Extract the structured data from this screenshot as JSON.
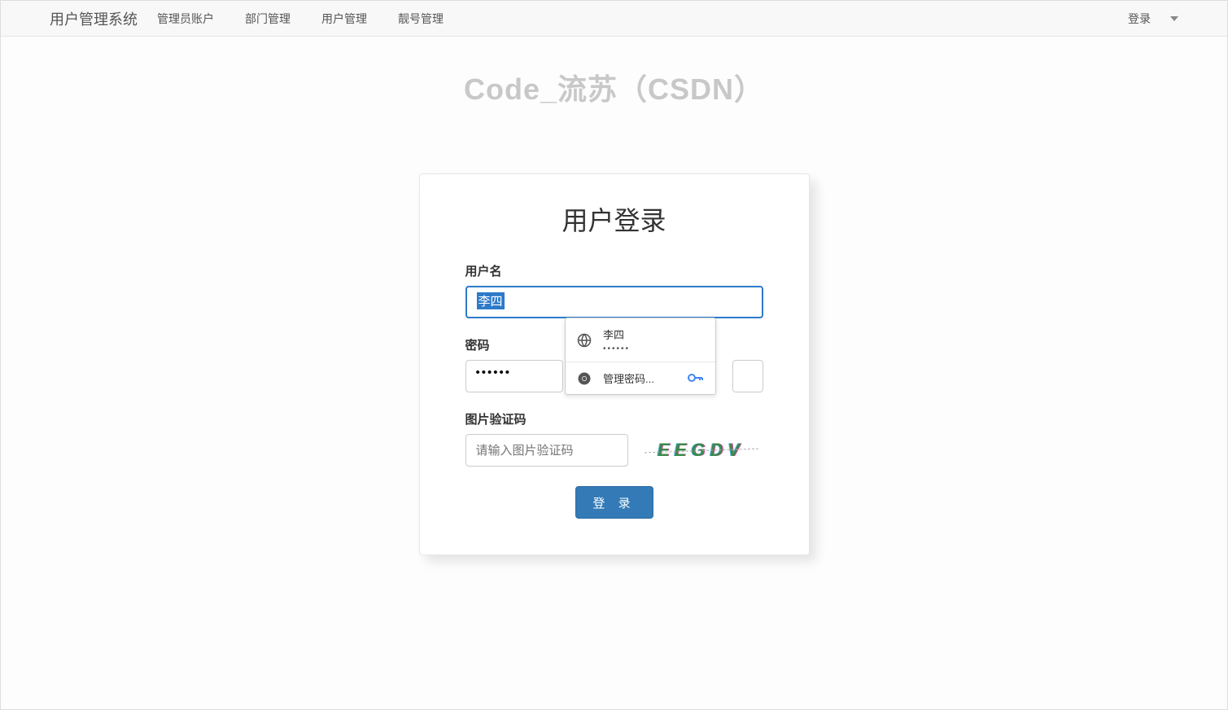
{
  "navbar": {
    "brand": "用户管理系统",
    "links": [
      "管理员账户",
      "部门管理",
      "用户管理",
      "靓号管理"
    ],
    "right_label": "登录"
  },
  "watermark": "Code_流苏（CSDN）",
  "login": {
    "title": "用户登录",
    "username_label": "用户名",
    "username_value": "李四",
    "password_label": "密码",
    "password_value": "••••••",
    "captcha_label": "图片验证码",
    "captcha_placeholder": "请输入图片验证码",
    "captcha_text": "EEGDV",
    "submit_label": "登 录"
  },
  "autofill": {
    "suggestion_user": "李四",
    "suggestion_pass": "••••••",
    "manage_label": "管理密码..."
  }
}
